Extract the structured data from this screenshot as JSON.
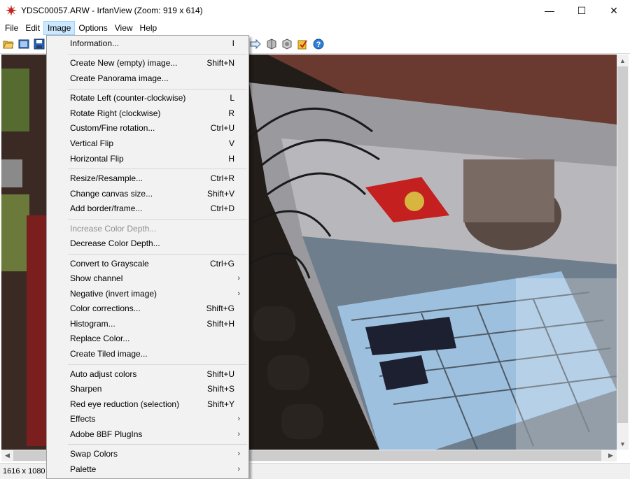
{
  "window": {
    "title": "YDSC00057.ARW - IrfanView (Zoom: 919 x 614)",
    "buttons": {
      "minimize": "—",
      "maximize": "☐",
      "close": "✕"
    }
  },
  "menubar": {
    "items": [
      {
        "label": "File"
      },
      {
        "label": "Edit"
      },
      {
        "label": "Image"
      },
      {
        "label": "Options"
      },
      {
        "label": "View"
      },
      {
        "label": "Help"
      }
    ]
  },
  "toolbar": {
    "icons": [
      "open-folder-icon",
      "slideshow-icon",
      "save-icon",
      "forward-arrow-icon",
      "zoom-in-icon",
      "zoom-out-icon",
      "paint-icon",
      "help-icon"
    ]
  },
  "image_menu": {
    "items": [
      {
        "label": "Information...",
        "shortcut": "I"
      },
      {
        "label": "Create New (empty) image...",
        "shortcut": "Shift+N"
      },
      {
        "label": "Create Panorama image...",
        "shortcut": ""
      },
      {
        "label": "Rotate Left (counter-clockwise)",
        "shortcut": "L"
      },
      {
        "label": "Rotate Right (clockwise)",
        "shortcut": "R"
      },
      {
        "label": "Custom/Fine rotation...",
        "shortcut": "Ctrl+U"
      },
      {
        "label": "Vertical Flip",
        "shortcut": "V"
      },
      {
        "label": "Horizontal Flip",
        "shortcut": "H"
      },
      {
        "label": "Resize/Resample...",
        "shortcut": "Ctrl+R"
      },
      {
        "label": "Change canvas size...",
        "shortcut": "Shift+V"
      },
      {
        "label": "Add border/frame...",
        "shortcut": "Ctrl+D"
      },
      {
        "label": "Increase Color Depth...",
        "shortcut": ""
      },
      {
        "label": "Decrease Color Depth...",
        "shortcut": ""
      },
      {
        "label": "Convert to Grayscale",
        "shortcut": "Ctrl+G"
      },
      {
        "label": "Show channel",
        "shortcut": ""
      },
      {
        "label": "Negative (invert image)",
        "shortcut": ""
      },
      {
        "label": "Color corrections...",
        "shortcut": "Shift+G"
      },
      {
        "label": "Histogram...",
        "shortcut": "Shift+H"
      },
      {
        "label": "Replace Color...",
        "shortcut": ""
      },
      {
        "label": "Create Tiled image...",
        "shortcut": ""
      },
      {
        "label": "Auto adjust colors",
        "shortcut": "Shift+U"
      },
      {
        "label": "Sharpen",
        "shortcut": "Shift+S"
      },
      {
        "label": "Red eye reduction (selection)",
        "shortcut": "Shift+Y"
      },
      {
        "label": "Effects",
        "shortcut": ""
      },
      {
        "label": "Adobe 8BF PlugIns",
        "shortcut": ""
      },
      {
        "label": "Swap Colors",
        "shortcut": ""
      },
      {
        "label": "Palette",
        "shortcut": ""
      }
    ],
    "submenu_arrow": "›"
  },
  "statusbar": {
    "text": "1616 x 1080 x"
  },
  "scroll_arrows": {
    "up": "▲",
    "down": "▼",
    "left": "◀",
    "right": "▶"
  },
  "colors": {
    "menu_highlight": "#cce8ff",
    "menu_background": "#f2f2f2",
    "disabled_text": "#8d8d8d"
  }
}
